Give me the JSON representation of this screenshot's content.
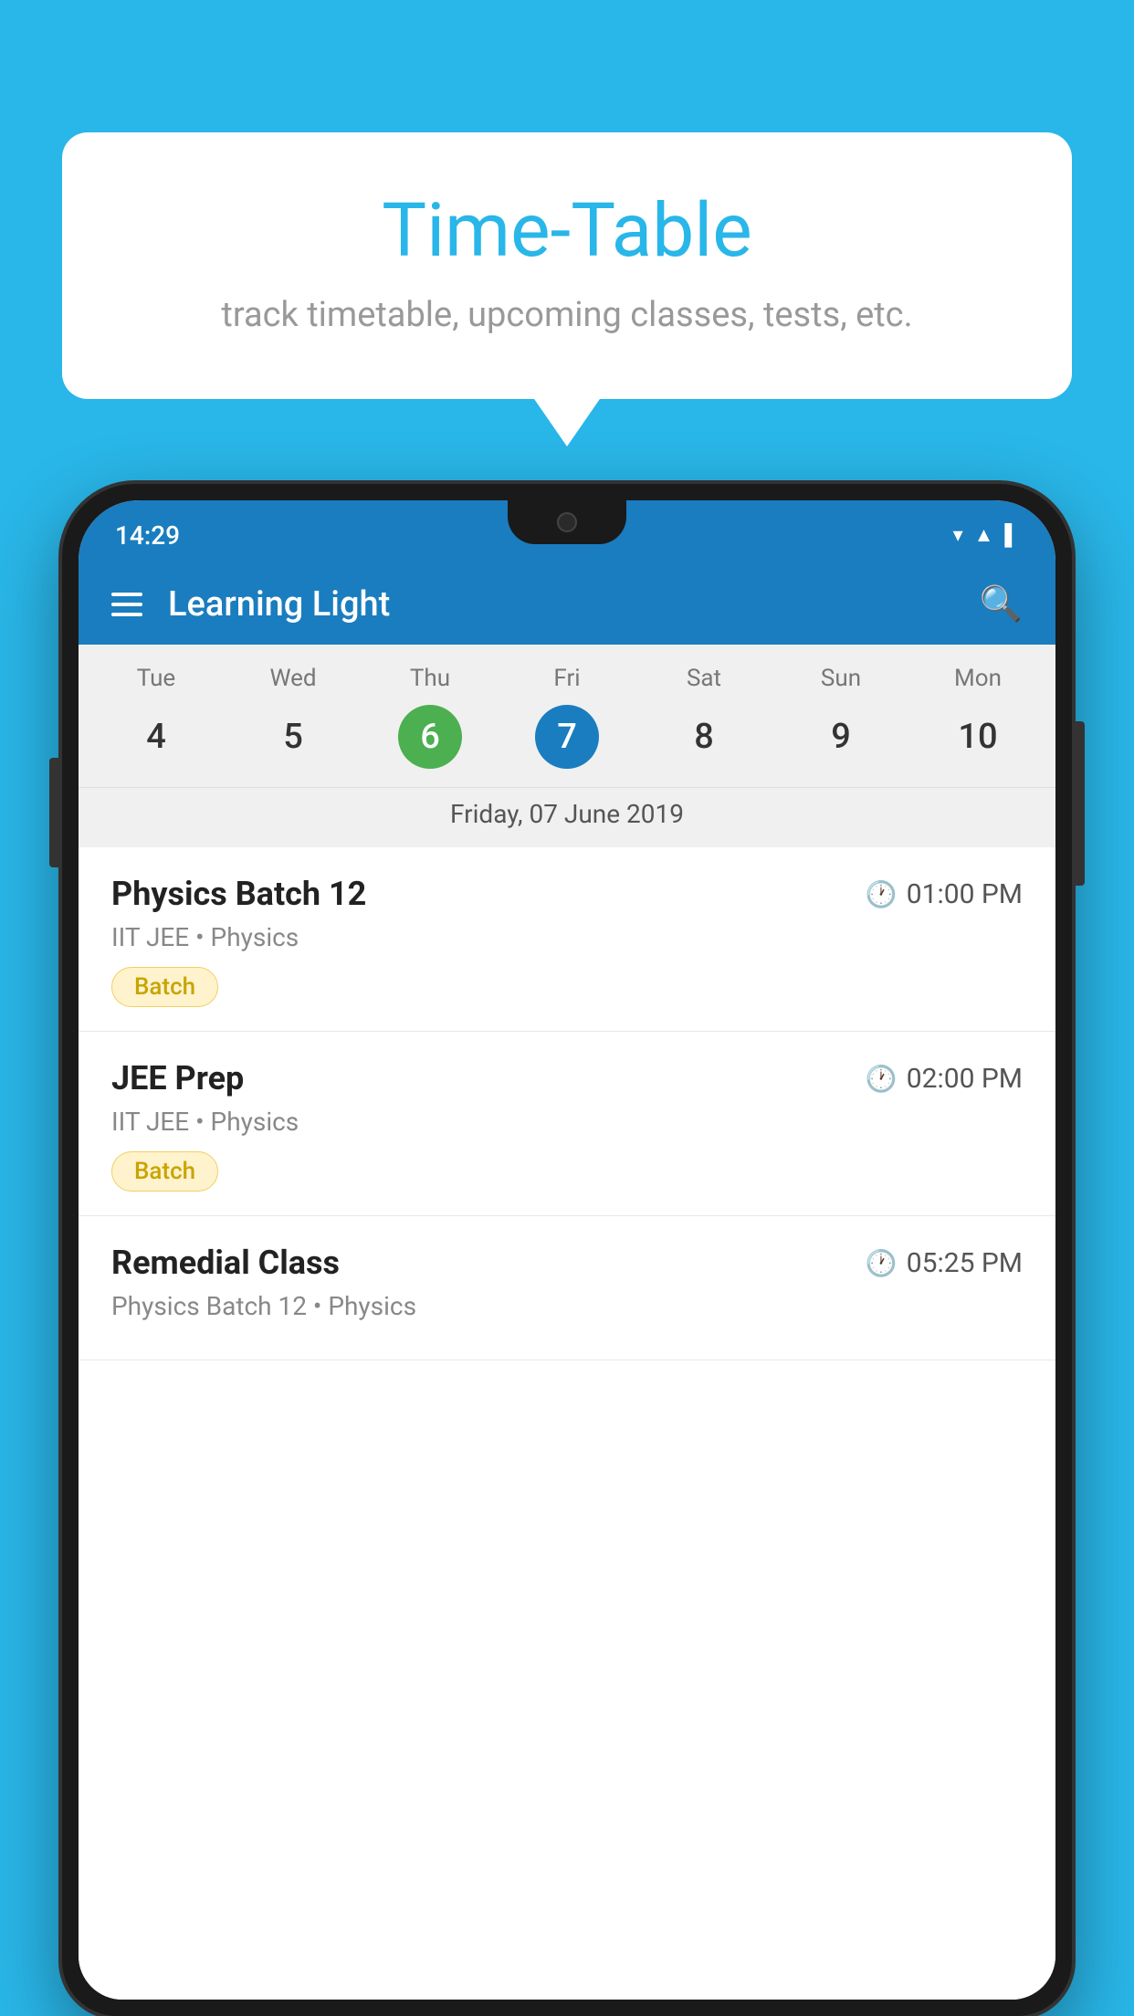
{
  "background_color": "#29b6e8",
  "bubble": {
    "title": "Time-Table",
    "subtitle": "track timetable, upcoming classes, tests, etc."
  },
  "phone": {
    "status_bar": {
      "time": "14:29"
    },
    "app_bar": {
      "title": "Learning Light"
    },
    "calendar": {
      "days": [
        {
          "name": "Tue",
          "num": "4",
          "state": "normal"
        },
        {
          "name": "Wed",
          "num": "5",
          "state": "normal"
        },
        {
          "name": "Thu",
          "num": "6",
          "state": "today"
        },
        {
          "name": "Fri",
          "num": "7",
          "state": "selected"
        },
        {
          "name": "Sat",
          "num": "8",
          "state": "normal"
        },
        {
          "name": "Sun",
          "num": "9",
          "state": "normal"
        },
        {
          "name": "Mon",
          "num": "10",
          "state": "normal"
        }
      ],
      "selected_date_label": "Friday, 07 June 2019"
    },
    "events": [
      {
        "title": "Physics Batch 12",
        "time": "01:00 PM",
        "subtitle": "IIT JEE • Physics",
        "badge": "Batch"
      },
      {
        "title": "JEE Prep",
        "time": "02:00 PM",
        "subtitle": "IIT JEE • Physics",
        "badge": "Batch"
      },
      {
        "title": "Remedial Class",
        "time": "05:25 PM",
        "subtitle": "Physics Batch 12 • Physics",
        "badge": null
      }
    ]
  }
}
